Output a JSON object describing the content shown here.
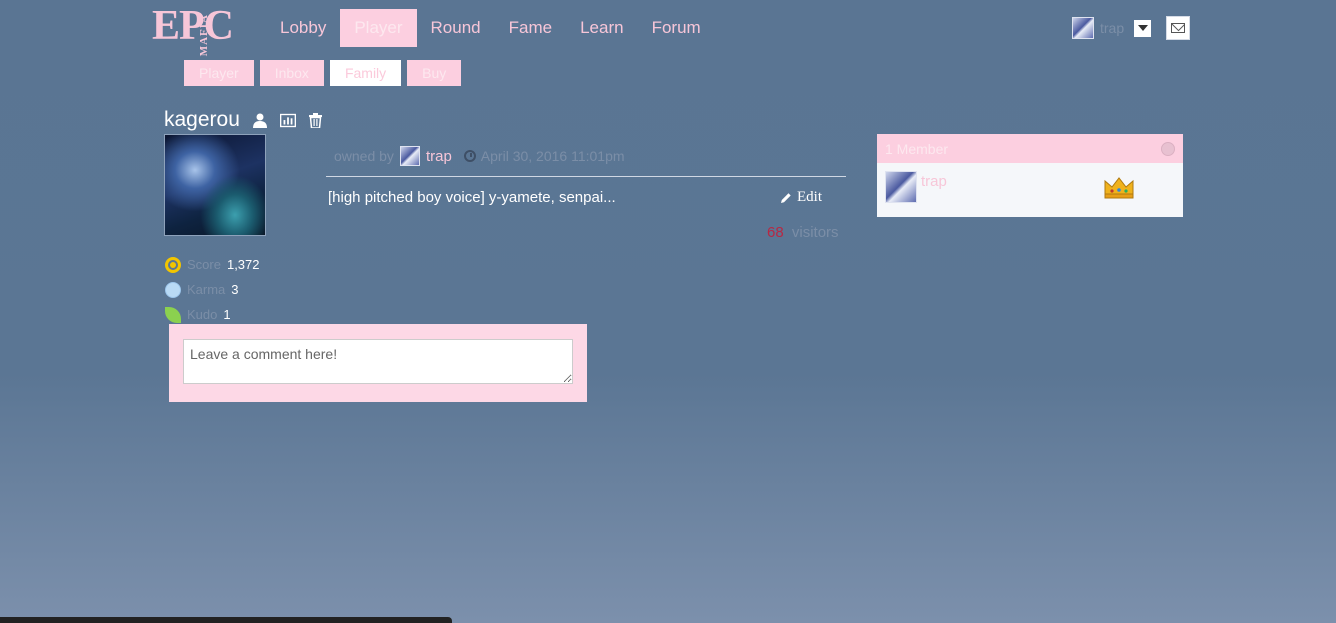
{
  "logo": {
    "big": "EPC",
    "small": "MAFIA"
  },
  "nav": {
    "items": [
      {
        "label": "Lobby",
        "active": false
      },
      {
        "label": "Player",
        "active": true
      },
      {
        "label": "Round",
        "active": false
      },
      {
        "label": "Fame",
        "active": false
      },
      {
        "label": "Learn",
        "active": false
      },
      {
        "label": "Forum",
        "active": false
      }
    ]
  },
  "user": {
    "name": "trap"
  },
  "subnav": {
    "items": [
      {
        "label": "Player",
        "active": false
      },
      {
        "label": "Inbox",
        "active": false
      },
      {
        "label": "Family",
        "active": true
      },
      {
        "label": "Buy",
        "active": false
      }
    ]
  },
  "family": {
    "name": "kagerou",
    "owned_by_label": "owned by",
    "owner": "trap",
    "date": "April 30, 2016 11:01pm",
    "description": "[high pitched boy voice] y-yamete, senpai...",
    "edit_label": "Edit",
    "visitors_count": "68",
    "visitors_label": "visitors"
  },
  "stats": {
    "score_label": "Score",
    "score_value": "1,372",
    "karma_label": "Karma",
    "karma_value": "3",
    "kudo_label": "Kudo",
    "kudo_value": "1"
  },
  "comment": {
    "placeholder": "Leave a comment here!"
  },
  "members": {
    "header": "1 Member",
    "list": [
      {
        "name": "trap",
        "role": "crown-icon"
      }
    ]
  },
  "colors": {
    "accent": "#fccfe0",
    "background": "#5a7593",
    "text_muted": "#7b8ea7",
    "visitor_count": "#b72844"
  }
}
